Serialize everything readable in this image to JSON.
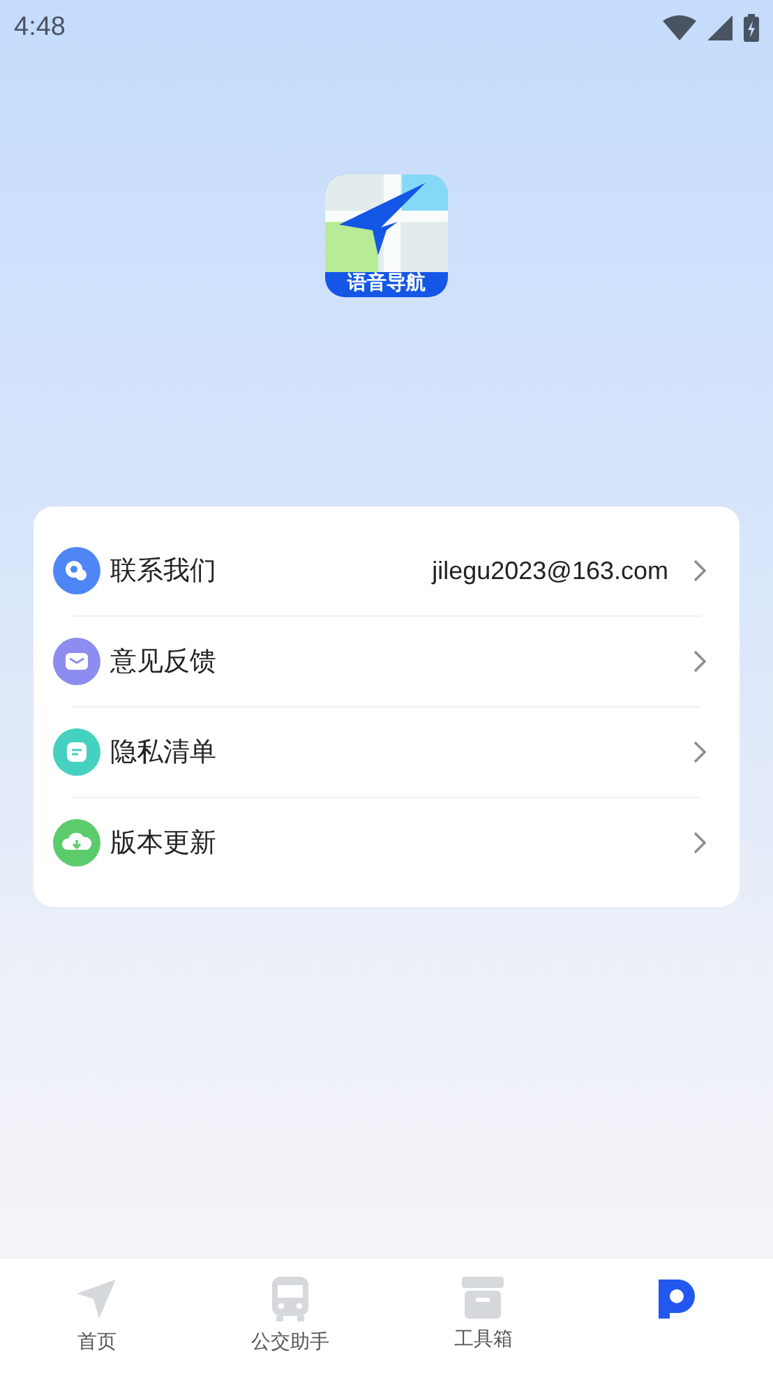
{
  "status_bar": {
    "time": "4:48"
  },
  "app_logo": {
    "label": "语音导航"
  },
  "menu": [
    {
      "kind": "chat",
      "label": "联系我们",
      "value": "jilegu2023@163.com",
      "color": "#4f86f7"
    },
    {
      "kind": "mail",
      "label": "意见反馈",
      "color": "#8d8cf0"
    },
    {
      "kind": "note",
      "label": "隐私清单",
      "color": "#45d1bf"
    },
    {
      "kind": "cloud",
      "label": "版本更新",
      "color": "#5ccb6c"
    }
  ],
  "tabs": [
    {
      "kind": "navigate",
      "label": "首页",
      "selected": false
    },
    {
      "kind": "bus",
      "label": "公交助手",
      "selected": false
    },
    {
      "kind": "box",
      "label": "工具箱",
      "selected": false
    },
    {
      "kind": "profile",
      "selected": true
    }
  ]
}
